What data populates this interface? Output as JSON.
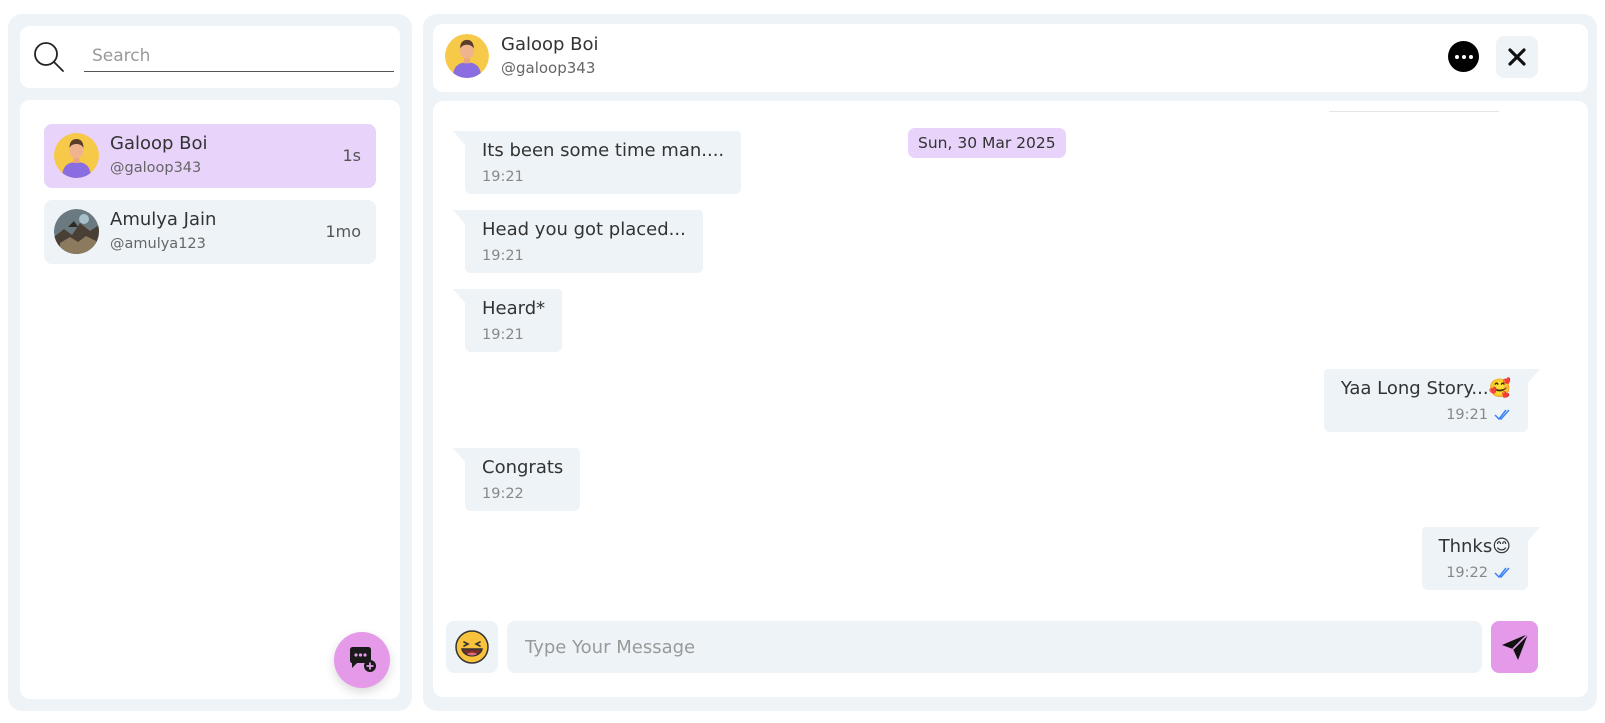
{
  "search": {
    "placeholder": "Search"
  },
  "contacts": [
    {
      "name": "Galoop Boi",
      "handle": "@galoop343",
      "time": "1s",
      "active": true
    },
    {
      "name": "Amulya Jain",
      "handle": "@amulya123",
      "time": "1mo",
      "active": false
    }
  ],
  "chat": {
    "name": "Galoop Boi",
    "handle": "@galoop343",
    "date": "Sun, 30 Mar 2025",
    "messages": [
      {
        "text": "Its been some time man....",
        "time": "19:21",
        "direction": "in"
      },
      {
        "text": "Head you got placed...",
        "time": "19:21",
        "direction": "in"
      },
      {
        "text": "Heard*",
        "time": "19:21",
        "direction": "in"
      },
      {
        "text": "Yaa Long Story...🥰",
        "time": "19:21",
        "direction": "out"
      },
      {
        "text": "Congrats",
        "time": "19:22",
        "direction": "in"
      },
      {
        "text": "Thnks😊",
        "time": "19:22",
        "direction": "out"
      }
    ]
  },
  "composer": {
    "placeholder": "Type Your Message"
  },
  "colors": {
    "accent": "#e49ae9",
    "active_contact": "#e8d3fa",
    "panel_bg": "#eef3f7",
    "tick": "#3b82f6"
  }
}
